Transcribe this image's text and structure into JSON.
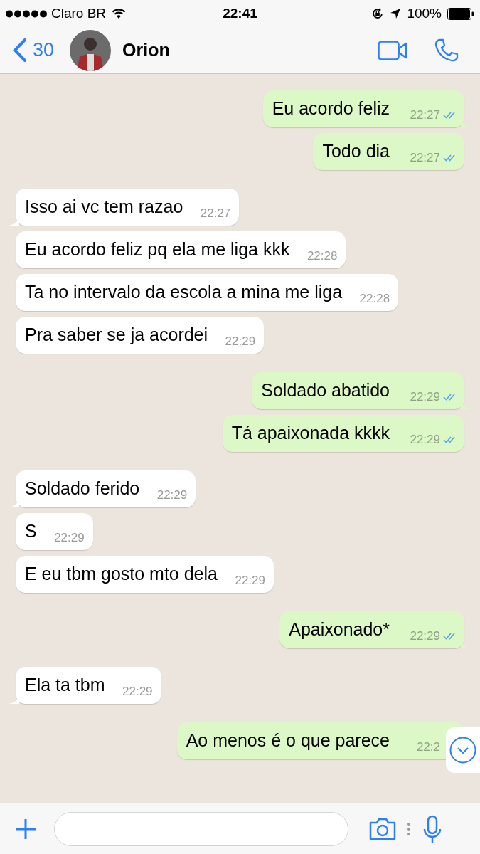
{
  "status_bar": {
    "carrier": "Claro BR",
    "time": "22:41",
    "battery": "100%"
  },
  "header": {
    "back_count": "30",
    "contact_name": "Orion"
  },
  "messages": [
    {
      "kind": "sent",
      "text": "Eu acordo feliz",
      "time": "22:27",
      "read": true
    },
    {
      "kind": "sent",
      "text": "Todo dia",
      "time": "22:27",
      "read": true
    },
    {
      "kind": "received",
      "text": "Isso ai vc tem razao",
      "time": "22:27"
    },
    {
      "kind": "received",
      "text": "Eu acordo feliz pq ela me liga kkk",
      "time": "22:28"
    },
    {
      "kind": "received",
      "text": "Ta no intervalo da escola a mina me liga",
      "time": "22:28"
    },
    {
      "kind": "received",
      "text": "Pra saber se ja acordei",
      "time": "22:29"
    },
    {
      "kind": "sent",
      "text": "Soldado abatido",
      "time": "22:29",
      "read": true
    },
    {
      "kind": "sent",
      "text": "Tá apaixonada kkkk",
      "time": "22:29",
      "read": true
    },
    {
      "kind": "received",
      "text": "Soldado ferido",
      "time": "22:29"
    },
    {
      "kind": "received",
      "text": "S",
      "time": "22:29"
    },
    {
      "kind": "received",
      "text": "E eu tbm gosto mto dela",
      "time": "22:29"
    },
    {
      "kind": "sent",
      "text": "Apaixonado*",
      "time": "22:29",
      "read": true
    },
    {
      "kind": "received",
      "text": "Ela ta tbm",
      "time": "22:29"
    },
    {
      "kind": "sent",
      "text": "Ao menos é o que parece",
      "time": "22:2"
    }
  ]
}
